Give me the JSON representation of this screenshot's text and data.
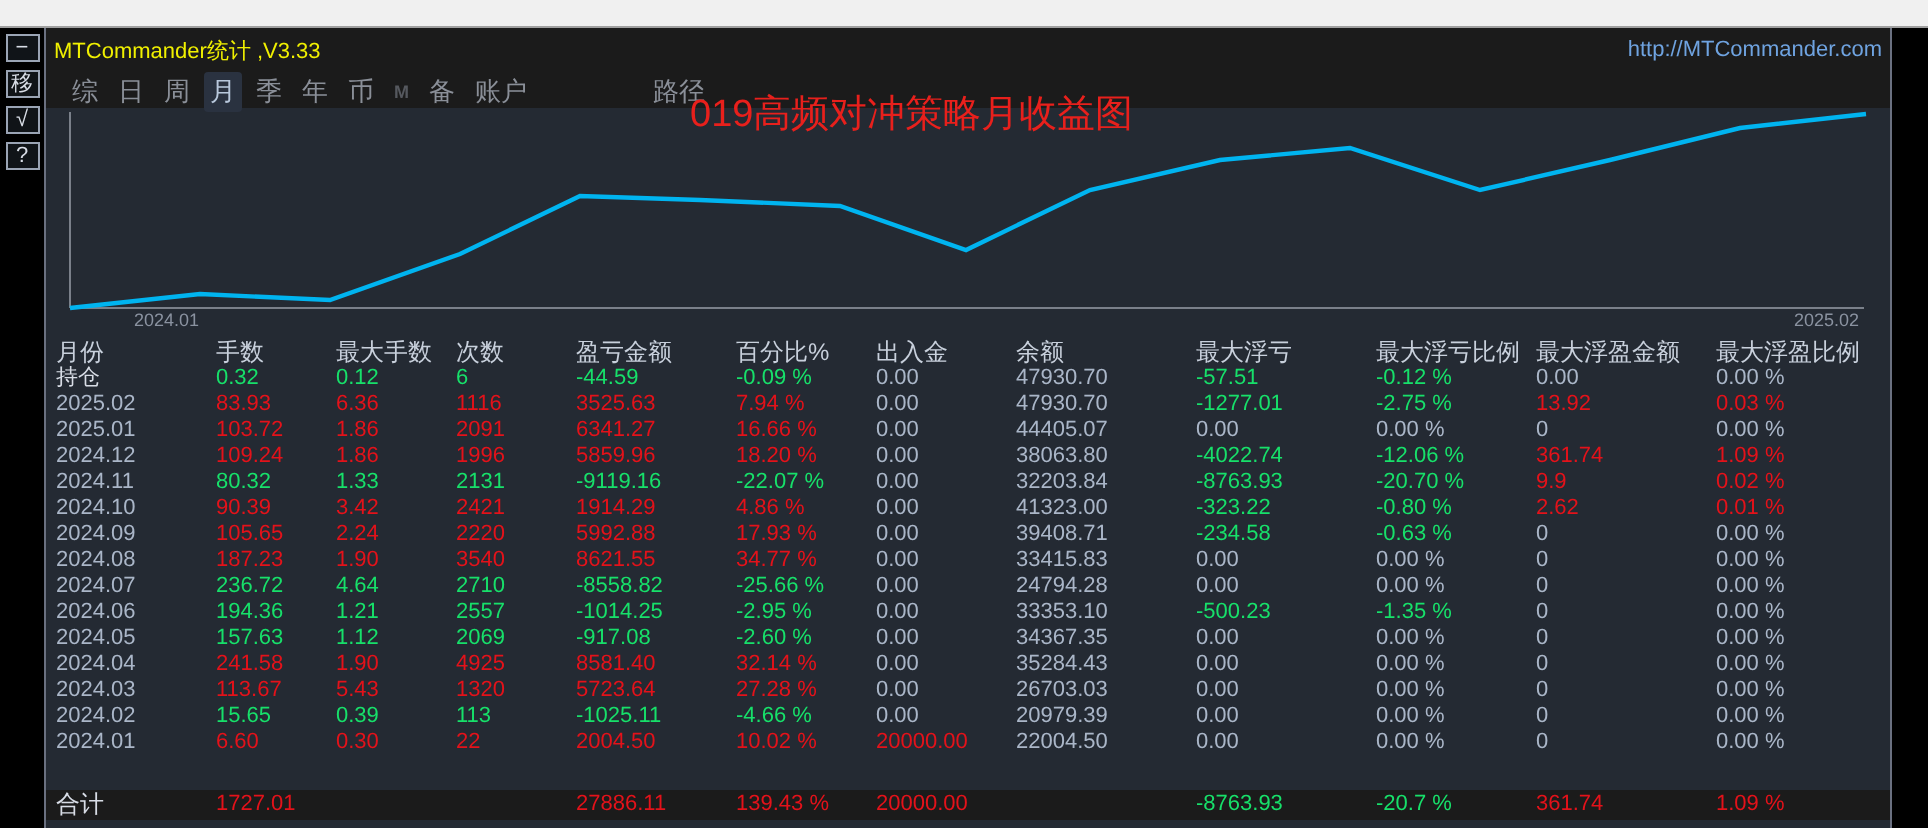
{
  "side_buttons": [
    "−",
    "移",
    "√",
    "?"
  ],
  "header": {
    "title": "MTCommander统计 ,V3.33",
    "link": "http://MTCommander.com"
  },
  "tabs": [
    {
      "label": "综",
      "selected": false,
      "disabled": false
    },
    {
      "label": "日",
      "selected": false,
      "disabled": false
    },
    {
      "label": "周",
      "selected": false,
      "disabled": false
    },
    {
      "label": "月",
      "selected": true,
      "disabled": false
    },
    {
      "label": "季",
      "selected": false,
      "disabled": false
    },
    {
      "label": "年",
      "selected": false,
      "disabled": false
    },
    {
      "label": "币",
      "selected": false,
      "disabled": false
    },
    {
      "label": "M",
      "selected": false,
      "disabled": true
    },
    {
      "label": "备",
      "selected": false,
      "disabled": false
    },
    {
      "label": "账户",
      "selected": false,
      "disabled": false
    }
  ],
  "path_label": "路径",
  "chart": {
    "title": "019高频对冲策略月收益图",
    "x_start": "2024.01",
    "x_end": "2025.02"
  },
  "table": {
    "columns": [
      "月份",
      "手数",
      "最大手数",
      "次数",
      "盈亏金额",
      "百分比%",
      "出入金",
      "余额",
      "最大浮亏",
      "最大浮亏比例",
      "最大浮盈金额",
      "最大浮盈比例"
    ],
    "rows": [
      {
        "cells": [
          {
            "text": "持仓",
            "color": "#d8dde6"
          },
          {
            "text": "0.32",
            "color": "#17e06a"
          },
          {
            "text": "0.12",
            "color": "#17e06a"
          },
          {
            "text": "6",
            "color": "#17e06a"
          },
          {
            "text": "-44.59",
            "color": "#17e06a"
          },
          {
            "text": "-0.09 %",
            "color": "#17e06a"
          },
          {
            "text": "0.00",
            "color": "#aab6c8"
          },
          {
            "text": "47930.70",
            "color": "#aab6c8"
          },
          {
            "text": "-57.51",
            "color": "#17e06a"
          },
          {
            "text": "-0.12 %",
            "color": "#17e06a"
          },
          {
            "text": "0.00",
            "color": "#aab6c8"
          },
          {
            "text": "0.00 %",
            "color": "#aab6c8"
          }
        ]
      },
      {
        "cells": [
          {
            "text": "2025.02",
            "color": "#aab6c8"
          },
          {
            "text": "83.93",
            "color": "#e3121a"
          },
          {
            "text": "6.36",
            "color": "#e3121a"
          },
          {
            "text": "1116",
            "color": "#e3121a"
          },
          {
            "text": "3525.63",
            "color": "#e3121a"
          },
          {
            "text": "7.94 %",
            "color": "#e3121a"
          },
          {
            "text": "0.00",
            "color": "#aab6c8"
          },
          {
            "text": "47930.70",
            "color": "#aab6c8"
          },
          {
            "text": "-1277.01",
            "color": "#17e06a"
          },
          {
            "text": "-2.75 %",
            "color": "#17e06a"
          },
          {
            "text": "13.92",
            "color": "#e3121a"
          },
          {
            "text": "0.03 %",
            "color": "#e3121a"
          }
        ]
      },
      {
        "cells": [
          {
            "text": "2025.01",
            "color": "#aab6c8"
          },
          {
            "text": "103.72",
            "color": "#e3121a"
          },
          {
            "text": "1.86",
            "color": "#e3121a"
          },
          {
            "text": "2091",
            "color": "#e3121a"
          },
          {
            "text": "6341.27",
            "color": "#e3121a"
          },
          {
            "text": "16.66 %",
            "color": "#e3121a"
          },
          {
            "text": "0.00",
            "color": "#aab6c8"
          },
          {
            "text": "44405.07",
            "color": "#aab6c8"
          },
          {
            "text": "0.00",
            "color": "#aab6c8"
          },
          {
            "text": "0.00 %",
            "color": "#aab6c8"
          },
          {
            "text": "0",
            "color": "#aab6c8"
          },
          {
            "text": "0.00 %",
            "color": "#aab6c8"
          }
        ]
      },
      {
        "cells": [
          {
            "text": "2024.12",
            "color": "#aab6c8"
          },
          {
            "text": "109.24",
            "color": "#e3121a"
          },
          {
            "text": "1.86",
            "color": "#e3121a"
          },
          {
            "text": "1996",
            "color": "#e3121a"
          },
          {
            "text": "5859.96",
            "color": "#e3121a"
          },
          {
            "text": "18.20 %",
            "color": "#e3121a"
          },
          {
            "text": "0.00",
            "color": "#aab6c8"
          },
          {
            "text": "38063.80",
            "color": "#aab6c8"
          },
          {
            "text": "-4022.74",
            "color": "#17e06a"
          },
          {
            "text": "-12.06 %",
            "color": "#17e06a"
          },
          {
            "text": "361.74",
            "color": "#e3121a"
          },
          {
            "text": "1.09 %",
            "color": "#e3121a"
          }
        ]
      },
      {
        "cells": [
          {
            "text": "2024.11",
            "color": "#aab6c8"
          },
          {
            "text": "80.32",
            "color": "#17e06a"
          },
          {
            "text": "1.33",
            "color": "#17e06a"
          },
          {
            "text": "2131",
            "color": "#17e06a"
          },
          {
            "text": "-9119.16",
            "color": "#17e06a"
          },
          {
            "text": "-22.07 %",
            "color": "#17e06a"
          },
          {
            "text": "0.00",
            "color": "#aab6c8"
          },
          {
            "text": "32203.84",
            "color": "#aab6c8"
          },
          {
            "text": "-8763.93",
            "color": "#17e06a"
          },
          {
            "text": "-20.70 %",
            "color": "#17e06a"
          },
          {
            "text": "9.9",
            "color": "#e3121a"
          },
          {
            "text": "0.02 %",
            "color": "#e3121a"
          }
        ]
      },
      {
        "cells": [
          {
            "text": "2024.10",
            "color": "#aab6c8"
          },
          {
            "text": "90.39",
            "color": "#e3121a"
          },
          {
            "text": "3.42",
            "color": "#e3121a"
          },
          {
            "text": "2421",
            "color": "#e3121a"
          },
          {
            "text": "1914.29",
            "color": "#e3121a"
          },
          {
            "text": "4.86 %",
            "color": "#e3121a"
          },
          {
            "text": "0.00",
            "color": "#aab6c8"
          },
          {
            "text": "41323.00",
            "color": "#aab6c8"
          },
          {
            "text": "-323.22",
            "color": "#17e06a"
          },
          {
            "text": "-0.80 %",
            "color": "#17e06a"
          },
          {
            "text": "2.62",
            "color": "#e3121a"
          },
          {
            "text": "0.01 %",
            "color": "#e3121a"
          }
        ]
      },
      {
        "cells": [
          {
            "text": "2024.09",
            "color": "#aab6c8"
          },
          {
            "text": "105.65",
            "color": "#e3121a"
          },
          {
            "text": "2.24",
            "color": "#e3121a"
          },
          {
            "text": "2220",
            "color": "#e3121a"
          },
          {
            "text": "5992.88",
            "color": "#e3121a"
          },
          {
            "text": "17.93 %",
            "color": "#e3121a"
          },
          {
            "text": "0.00",
            "color": "#aab6c8"
          },
          {
            "text": "39408.71",
            "color": "#aab6c8"
          },
          {
            "text": "-234.58",
            "color": "#17e06a"
          },
          {
            "text": "-0.63 %",
            "color": "#17e06a"
          },
          {
            "text": "0",
            "color": "#aab6c8"
          },
          {
            "text": "0.00 %",
            "color": "#aab6c8"
          }
        ]
      },
      {
        "cells": [
          {
            "text": "2024.08",
            "color": "#aab6c8"
          },
          {
            "text": "187.23",
            "color": "#e3121a"
          },
          {
            "text": "1.90",
            "color": "#e3121a"
          },
          {
            "text": "3540",
            "color": "#e3121a"
          },
          {
            "text": "8621.55",
            "color": "#e3121a"
          },
          {
            "text": "34.77 %",
            "color": "#e3121a"
          },
          {
            "text": "0.00",
            "color": "#aab6c8"
          },
          {
            "text": "33415.83",
            "color": "#aab6c8"
          },
          {
            "text": "0.00",
            "color": "#aab6c8"
          },
          {
            "text": "0.00 %",
            "color": "#aab6c8"
          },
          {
            "text": "0",
            "color": "#aab6c8"
          },
          {
            "text": "0.00 %",
            "color": "#aab6c8"
          }
        ]
      },
      {
        "cells": [
          {
            "text": "2024.07",
            "color": "#aab6c8"
          },
          {
            "text": "236.72",
            "color": "#17e06a"
          },
          {
            "text": "4.64",
            "color": "#17e06a"
          },
          {
            "text": "2710",
            "color": "#17e06a"
          },
          {
            "text": "-8558.82",
            "color": "#17e06a"
          },
          {
            "text": "-25.66 %",
            "color": "#17e06a"
          },
          {
            "text": "0.00",
            "color": "#aab6c8"
          },
          {
            "text": "24794.28",
            "color": "#aab6c8"
          },
          {
            "text": "0.00",
            "color": "#aab6c8"
          },
          {
            "text": "0.00 %",
            "color": "#aab6c8"
          },
          {
            "text": "0",
            "color": "#aab6c8"
          },
          {
            "text": "0.00 %",
            "color": "#aab6c8"
          }
        ]
      },
      {
        "cells": [
          {
            "text": "2024.06",
            "color": "#aab6c8"
          },
          {
            "text": "194.36",
            "color": "#17e06a"
          },
          {
            "text": "1.21",
            "color": "#17e06a"
          },
          {
            "text": "2557",
            "color": "#17e06a"
          },
          {
            "text": "-1014.25",
            "color": "#17e06a"
          },
          {
            "text": "-2.95 %",
            "color": "#17e06a"
          },
          {
            "text": "0.00",
            "color": "#aab6c8"
          },
          {
            "text": "33353.10",
            "color": "#aab6c8"
          },
          {
            "text": "-500.23",
            "color": "#17e06a"
          },
          {
            "text": "-1.35 %",
            "color": "#17e06a"
          },
          {
            "text": "0",
            "color": "#aab6c8"
          },
          {
            "text": "0.00 %",
            "color": "#aab6c8"
          }
        ]
      },
      {
        "cells": [
          {
            "text": "2024.05",
            "color": "#aab6c8"
          },
          {
            "text": "157.63",
            "color": "#17e06a"
          },
          {
            "text": "1.12",
            "color": "#17e06a"
          },
          {
            "text": "2069",
            "color": "#17e06a"
          },
          {
            "text": "-917.08",
            "color": "#17e06a"
          },
          {
            "text": "-2.60 %",
            "color": "#17e06a"
          },
          {
            "text": "0.00",
            "color": "#aab6c8"
          },
          {
            "text": "34367.35",
            "color": "#aab6c8"
          },
          {
            "text": "0.00",
            "color": "#aab6c8"
          },
          {
            "text": "0.00 %",
            "color": "#aab6c8"
          },
          {
            "text": "0",
            "color": "#aab6c8"
          },
          {
            "text": "0.00 %",
            "color": "#aab6c8"
          }
        ]
      },
      {
        "cells": [
          {
            "text": "2024.04",
            "color": "#aab6c8"
          },
          {
            "text": "241.58",
            "color": "#e3121a"
          },
          {
            "text": "1.90",
            "color": "#e3121a"
          },
          {
            "text": "4925",
            "color": "#e3121a"
          },
          {
            "text": "8581.40",
            "color": "#e3121a"
          },
          {
            "text": "32.14 %",
            "color": "#e3121a"
          },
          {
            "text": "0.00",
            "color": "#aab6c8"
          },
          {
            "text": "35284.43",
            "color": "#aab6c8"
          },
          {
            "text": "0.00",
            "color": "#aab6c8"
          },
          {
            "text": "0.00 %",
            "color": "#aab6c8"
          },
          {
            "text": "0",
            "color": "#aab6c8"
          },
          {
            "text": "0.00 %",
            "color": "#aab6c8"
          }
        ]
      },
      {
        "cells": [
          {
            "text": "2024.03",
            "color": "#aab6c8"
          },
          {
            "text": "113.67",
            "color": "#e3121a"
          },
          {
            "text": "5.43",
            "color": "#e3121a"
          },
          {
            "text": "1320",
            "color": "#e3121a"
          },
          {
            "text": "5723.64",
            "color": "#e3121a"
          },
          {
            "text": "27.28 %",
            "color": "#e3121a"
          },
          {
            "text": "0.00",
            "color": "#aab6c8"
          },
          {
            "text": "26703.03",
            "color": "#aab6c8"
          },
          {
            "text": "0.00",
            "color": "#aab6c8"
          },
          {
            "text": "0.00 %",
            "color": "#aab6c8"
          },
          {
            "text": "0",
            "color": "#aab6c8"
          },
          {
            "text": "0.00 %",
            "color": "#aab6c8"
          }
        ]
      },
      {
        "cells": [
          {
            "text": "2024.02",
            "color": "#aab6c8"
          },
          {
            "text": "15.65",
            "color": "#17e06a"
          },
          {
            "text": "0.39",
            "color": "#17e06a"
          },
          {
            "text": "113",
            "color": "#17e06a"
          },
          {
            "text": "-1025.11",
            "color": "#17e06a"
          },
          {
            "text": "-4.66 %",
            "color": "#17e06a"
          },
          {
            "text": "0.00",
            "color": "#aab6c8"
          },
          {
            "text": "20979.39",
            "color": "#aab6c8"
          },
          {
            "text": "0.00",
            "color": "#aab6c8"
          },
          {
            "text": "0.00 %",
            "color": "#aab6c8"
          },
          {
            "text": "0",
            "color": "#aab6c8"
          },
          {
            "text": "0.00 %",
            "color": "#aab6c8"
          }
        ]
      },
      {
        "cells": [
          {
            "text": "2024.01",
            "color": "#aab6c8"
          },
          {
            "text": "6.60",
            "color": "#e3121a"
          },
          {
            "text": "0.30",
            "color": "#e3121a"
          },
          {
            "text": "22",
            "color": "#e3121a"
          },
          {
            "text": "2004.50",
            "color": "#e3121a"
          },
          {
            "text": "10.02 %",
            "color": "#e3121a"
          },
          {
            "text": "20000.00",
            "color": "#e3121a"
          },
          {
            "text": "22004.50",
            "color": "#aab6c8"
          },
          {
            "text": "0.00",
            "color": "#aab6c8"
          },
          {
            "text": "0.00 %",
            "color": "#aab6c8"
          },
          {
            "text": "0",
            "color": "#aab6c8"
          },
          {
            "text": "0.00 %",
            "color": "#aab6c8"
          }
        ]
      }
    ],
    "total": {
      "cells": [
        {
          "text": "合计",
          "color": "#d8dde6"
        },
        {
          "text": "1727.01",
          "color": "#e3121a"
        },
        null,
        null,
        {
          "text": "27886.11",
          "color": "#e3121a"
        },
        {
          "text": "139.43 %",
          "color": "#e3121a"
        },
        {
          "text": "20000.00",
          "color": "#e3121a"
        },
        null,
        {
          "text": "-8763.93",
          "color": "#17e06a"
        },
        {
          "text": "-20.7 %",
          "color": "#17e06a"
        },
        {
          "text": "361.74",
          "color": "#e3121a"
        },
        {
          "text": "1.09 %",
          "color": "#e3121a"
        }
      ]
    }
  }
}
